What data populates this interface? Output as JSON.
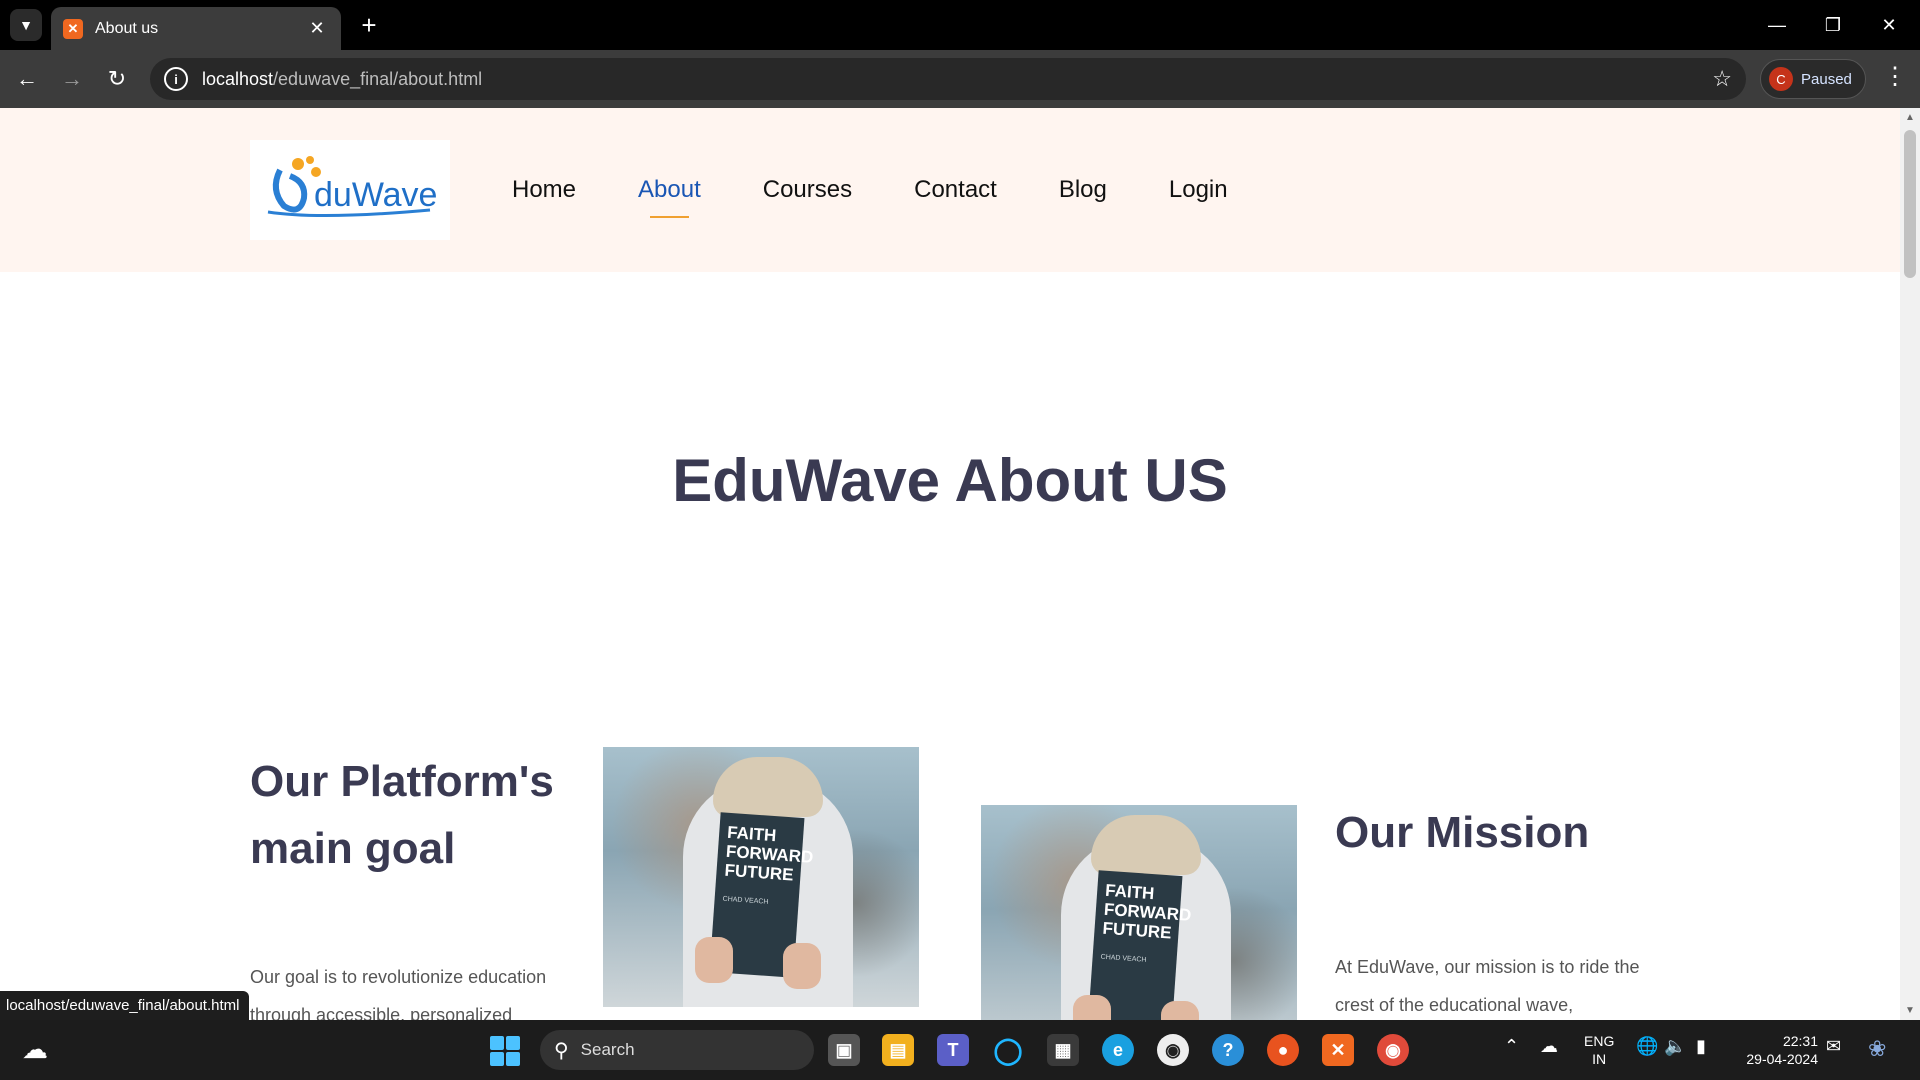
{
  "browser": {
    "tab_title": "About us",
    "tab_favicon_glyph": "✕",
    "new_tab_glyph": "+",
    "url_host": "localhost",
    "url_path": "/eduwave_final/about.html",
    "profile_initial": "C",
    "profile_status": "Paused",
    "colors": {
      "tabstrip": "#000000",
      "toolbar": "#3c3c3c",
      "omnibox": "#282828",
      "favicon": "#f06820"
    }
  },
  "site": {
    "logo_text": "duWave",
    "nav": [
      {
        "label": "Home",
        "active": false
      },
      {
        "label": "About",
        "active": true
      },
      {
        "label": "Courses",
        "active": false
      },
      {
        "label": "Contact",
        "active": false
      },
      {
        "label": "Blog",
        "active": false
      },
      {
        "label": "Login",
        "active": false
      }
    ],
    "colors": {
      "header_bg": "#fff5f0",
      "nav_active": "#1a56b4",
      "nav_underline": "#f0a030",
      "heading": "#3a3a52"
    }
  },
  "hero": {
    "title": "EduWave About US"
  },
  "goal": {
    "heading_line1": "Our Platform's",
    "heading_line2": "main goal",
    "text": "Our goal is to revolutionize education through accessible, personalized"
  },
  "mission": {
    "heading": "Our Mission",
    "text": "At EduWave, our mission is to ride the crest of the educational wave,"
  },
  "photo": {
    "book_title_line1": "FAITH",
    "book_title_line2": "FORWARD",
    "book_title_line3": "FUTURE",
    "book_author": "CHAD VEACH"
  },
  "status_tooltip": "localhost/eduwave_final/about.html",
  "taskbar": {
    "search_label": "Search",
    "lang_line1": "ENG",
    "lang_line2": "IN",
    "time": "22:31",
    "date": "29-04-2024"
  }
}
